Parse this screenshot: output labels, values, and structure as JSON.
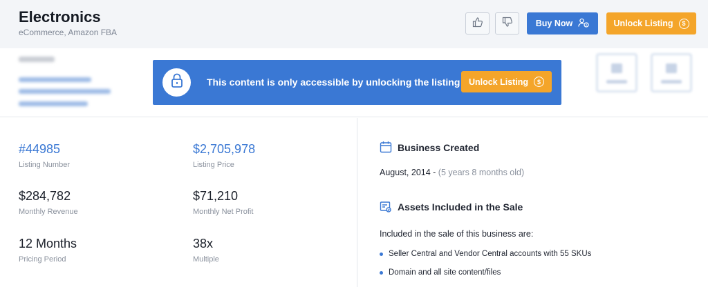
{
  "header": {
    "title": "Electronics",
    "subtitle": "eCommerce, Amazon FBA",
    "buy_label": "Buy Now",
    "unlock_label": "Unlock Listing"
  },
  "locked": {
    "message": "This content is only accessible by unlocking the listing",
    "unlock_label": "Unlock Listing"
  },
  "stats": [
    {
      "value": "#44985",
      "label": "Listing Number"
    },
    {
      "value": "$2,705,978",
      "label": "Listing Price"
    },
    {
      "value": "$284,782",
      "label": "Monthly Revenue"
    },
    {
      "value": "$71,210",
      "label": "Monthly Net Profit"
    },
    {
      "value": "12 Months",
      "label": "Pricing Period"
    },
    {
      "value": "38x",
      "label": "Multiple"
    }
  ],
  "created": {
    "title": "Business Created",
    "date": "August, 2014 - ",
    "age": "(5 years 8 months old)"
  },
  "assets": {
    "title": "Assets Included in the Sale",
    "intro": "Included in the sale of this business are:",
    "items": [
      "Seller Central and Vendor Central accounts with 55 SKUs",
      "Domain and all site content/files"
    ]
  },
  "colors": {
    "primary": "#3a78d4",
    "accent": "#f4a52a"
  },
  "icons": {
    "thumbs_up": "thumbs-up-icon",
    "thumbs_down": "thumbs-down-icon",
    "buy": "user-dollar-icon",
    "unlock": "coin-dollar-icon",
    "lock": "lock-icon",
    "calendar": "calendar-icon",
    "assets": "certificate-icon"
  }
}
